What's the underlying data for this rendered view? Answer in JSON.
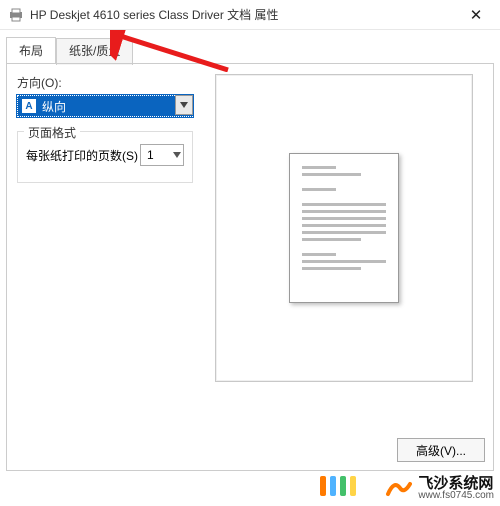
{
  "window": {
    "title": "HP Deskjet 4610 series Class Driver 文档 属性",
    "close_glyph": "✕"
  },
  "tabs": {
    "layout": "布局",
    "paper_quality": "纸张/质量"
  },
  "orientation": {
    "label": "方向(O):",
    "value": "纵向",
    "icon_letter": "A"
  },
  "page_format": {
    "title": "页面格式",
    "pps_label": "每张纸打印的页数(S)",
    "pps_value": "1"
  },
  "advanced_button": "高级(V)...",
  "watermark": {
    "name": "飞沙系统网",
    "url": "www.fs0745.com"
  },
  "accent_colors": [
    "#ff7a00",
    "#4fb3ff",
    "#43c06a",
    "#ffd447"
  ]
}
